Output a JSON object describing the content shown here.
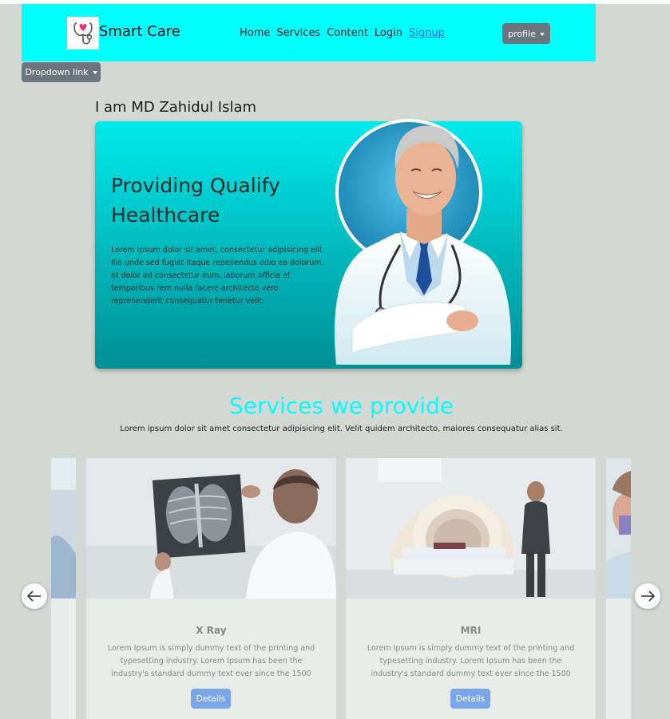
{
  "navbar": {
    "brand": "Smart Care",
    "links": [
      "Home",
      "Services",
      "Content",
      "Login",
      "Signup"
    ],
    "profile_label": "profile",
    "bg_color": "#00ffff"
  },
  "dropdown": {
    "label": "Dropdown link"
  },
  "hero": {
    "name": "I am MD Zahidul Islam",
    "title": "Providing Qualify Healthcare",
    "text": "Lorem ipsum dolor sit amet, consectetur adipisicing elit. Illo unde sed fugiat itaque repellendus odio ea dolorum, at dolor ad consectetur eum, laborum officia et temporibus rem nulla facere architecto vero reprehenderit consequatur tenetur velit."
  },
  "services": {
    "title": "Services we provide",
    "subtitle": "Lorem ipsum dolor sit amet consectetur adipisicing elit. Velit quidem architecto, maiores consequatur alias sit.",
    "cards": [
      {
        "title": "X Ray",
        "text": "Lorem Ipsum is simply dummy text of the printing and typesetting industry. Lorem Ipsum has been the industry's standard dummy text ever since the 1500",
        "button": "Details"
      },
      {
        "title": "MRI",
        "text": "Lorem Ipsum is simply dummy text of the printing and typesetting industry. Lorem Ipsum has been the industry's standard dummy text ever since the 1500",
        "button": "Details"
      }
    ]
  },
  "icons": {
    "logo": "stethoscope-heart-icon",
    "prev": "arrow-left-icon",
    "next": "arrow-right-icon"
  }
}
